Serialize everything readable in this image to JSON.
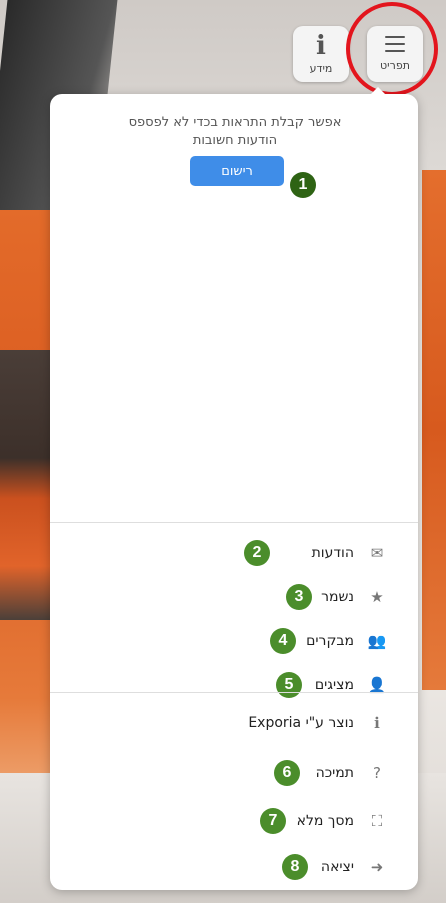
{
  "toolbar": {
    "info_label": "מידע",
    "menu_label": "תפריט",
    "info_icon": "i"
  },
  "notification": {
    "text": "אפשר קבלת התראות בכדי לא לפספס הודעות חשובות",
    "register_label": "רישום"
  },
  "menu": {
    "items": [
      {
        "label": "הודעות",
        "icon": "envelope-icon",
        "glyph": "✉"
      },
      {
        "label": "נשמר",
        "icon": "star-icon",
        "glyph": "★"
      },
      {
        "label": "מבקרים",
        "icon": "users-icon",
        "glyph": "👥"
      },
      {
        "label": "מציגים",
        "icon": "user-tie-icon",
        "glyph": "👤"
      },
      {
        "label": "נוצר ע\"י Exporia",
        "icon": "info-circle-icon",
        "glyph": "ℹ"
      },
      {
        "label": "תמיכה",
        "icon": "question-circle-icon",
        "glyph": "?"
      },
      {
        "label": "מסך מלא",
        "icon": "expand-icon",
        "glyph": "⛶"
      },
      {
        "label": "יציאה",
        "icon": "sign-out-icon",
        "glyph": "➜"
      }
    ]
  },
  "badges": [
    "1",
    "2",
    "3",
    "4",
    "5",
    "6",
    "7",
    "8"
  ],
  "colors": {
    "accent_blue": "#3f8de8",
    "badge_green": "#4b8d2b",
    "highlight_red": "#e3151d"
  }
}
